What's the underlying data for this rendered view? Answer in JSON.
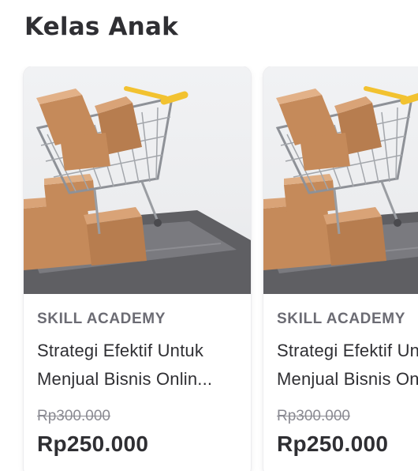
{
  "section": {
    "title": "Kelas Anak"
  },
  "courses": [
    {
      "provider": "SKILL ACADEMY",
      "title_line1": "Strategi Efektif Untuk",
      "title_line2": "Menjual Bisnis Onlin...",
      "price_old": "Rp300.000",
      "price_new": "Rp250.000"
    },
    {
      "provider": "SKILL ACADEMY",
      "title_line1": "Strategi Efektif Untuk",
      "title_line2": "Menjual Bisnis Online",
      "price_old": "Rp300.000",
      "price_new": "Rp250.000"
    }
  ],
  "colors": {
    "text_primary": "#2f2f33",
    "text_secondary": "#6b6b73",
    "strike_price": "#8a8a92",
    "cart_handle": "#f2c230",
    "box": "#c58a5a"
  }
}
